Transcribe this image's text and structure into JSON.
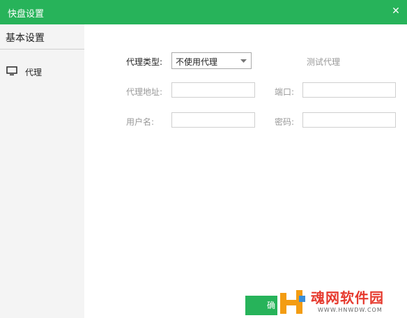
{
  "window": {
    "title": "快盘设置",
    "close_symbol": "✕",
    "accent_color": "#27b35a"
  },
  "sidebar": {
    "header": "基本设置",
    "items": [
      {
        "label": "代理",
        "icon": "monitor-icon"
      }
    ]
  },
  "form": {
    "proxy_type_label": "代理类型:",
    "proxy_type_value": "不使用代理",
    "test_proxy_label": "测试代理",
    "proxy_address_label": "代理地址:",
    "proxy_address_value": "",
    "port_label": "端口:",
    "port_value": "",
    "username_label": "用户名:",
    "username_value": "",
    "password_label": "密码:",
    "password_value": ""
  },
  "footer": {
    "confirm_label": "确"
  },
  "watermark": {
    "title": "魂网软件园",
    "url": "WWW.HNWDW.COM"
  }
}
